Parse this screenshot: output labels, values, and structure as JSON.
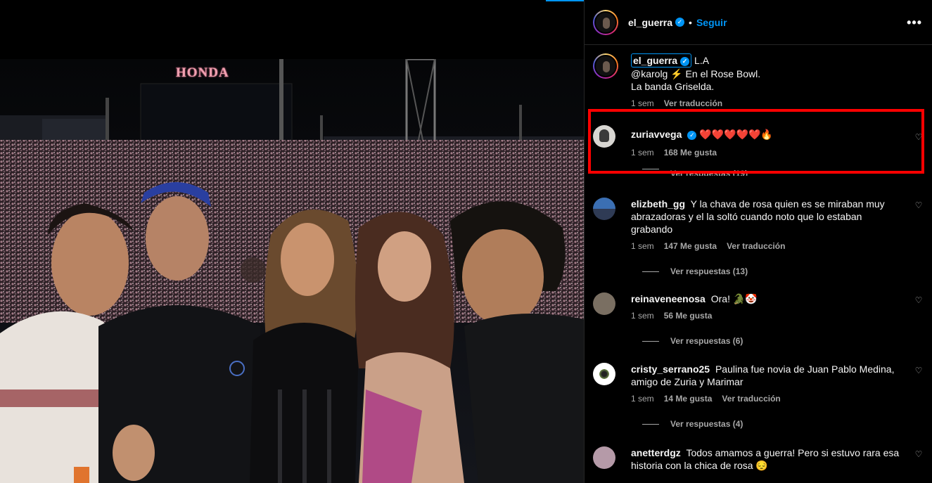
{
  "post": {
    "author": "el_guerra",
    "follow_label": "Seguir",
    "more_label": "•••",
    "photo_sign": "HONDA",
    "caption": {
      "username": "el_guerra",
      "text_suffix": "L.A",
      "line2": "@karolg ⚡ En el Rose Bowl.",
      "line3": "La banda Griselda.",
      "time": "1 sem",
      "translate": "Ver traducción"
    }
  },
  "comments": [
    {
      "username": "zuriavvega",
      "verified": true,
      "text": "❤️❤️❤️❤️❤️🔥",
      "time": "1 sem",
      "likes": "168 Me gusta",
      "translate": "",
      "replies": "Ver respuestas (19)",
      "highlighted": true
    },
    {
      "username": "elizbeth_gg",
      "text": "Y la chava de rosa quien es se miraban muy abrazadoras y el la soltó cuando noto que lo estaban grabando",
      "time": "1 sem",
      "likes": "147 Me gusta",
      "translate": "Ver traducción",
      "replies": "Ver respuestas (13)"
    },
    {
      "username": "reinaveneenosa",
      "text": "Ora! 🐊🤡",
      "time": "1 sem",
      "likes": "56 Me gusta",
      "translate": "",
      "replies": "Ver respuestas (6)"
    },
    {
      "username": "cristy_serrano25",
      "text": "Paulina fue novia de Juan Pablo Medina, amigo de Zuria y Marimar",
      "time": "1 sem",
      "likes": "14 Me gusta",
      "translate": "Ver traducción",
      "replies": "Ver respuestas (4)"
    },
    {
      "username": "anetterdgz",
      "text": "Todos amamos a guerra! Pero si estuvo rara esa historia con la chica de rosa 😔",
      "time": "",
      "likes": "",
      "translate": "",
      "replies": ""
    }
  ],
  "colors": {
    "accent": "#0095f6",
    "highlight": "#ff0000",
    "background": "#000000",
    "muted": "#a8a8a8"
  },
  "icons": [
    "verified-badge-icon",
    "heart-icon",
    "more-options-icon"
  ]
}
